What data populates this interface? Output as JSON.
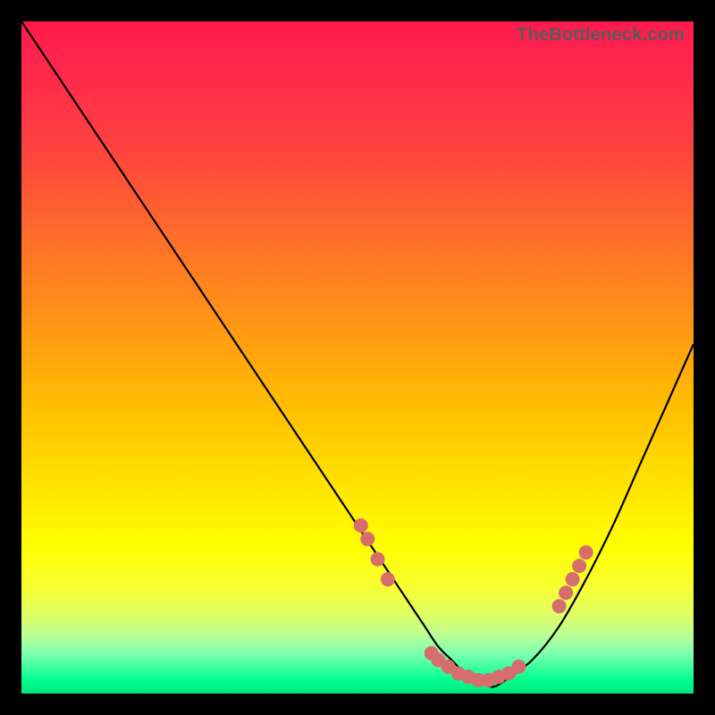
{
  "watermark": "TheBottleneck.com",
  "chart_data": {
    "type": "line",
    "title": "",
    "xlabel": "",
    "ylabel": "",
    "xlim": [
      0,
      100
    ],
    "ylim": [
      0,
      100
    ],
    "series": [
      {
        "name": "curve",
        "x": [
          0,
          4,
          8,
          12,
          16,
          20,
          24,
          28,
          32,
          36,
          40,
          44,
          48,
          50,
          52,
          54,
          56,
          58,
          60,
          62,
          64,
          66,
          68,
          70,
          72,
          76,
          80,
          84,
          88,
          92,
          96,
          100
        ],
        "y": [
          100,
          94,
          88,
          82,
          76,
          70,
          64,
          58,
          52,
          46,
          40,
          34,
          28,
          25,
          22,
          19,
          16,
          13,
          10,
          7,
          5,
          3,
          2,
          1,
          2,
          5,
          10,
          17,
          25,
          34,
          43,
          52
        ]
      }
    ],
    "markers": {
      "name": "dots",
      "color": "#d86d6d",
      "radius": 8,
      "points": [
        {
          "x": 50.5,
          "y": 25
        },
        {
          "x": 51.5,
          "y": 23
        },
        {
          "x": 53.0,
          "y": 20
        },
        {
          "x": 54.5,
          "y": 17
        },
        {
          "x": 61.0,
          "y": 6
        },
        {
          "x": 62.0,
          "y": 5
        },
        {
          "x": 63.5,
          "y": 4
        },
        {
          "x": 65.0,
          "y": 3
        },
        {
          "x": 66.5,
          "y": 2.5
        },
        {
          "x": 68.0,
          "y": 2
        },
        {
          "x": 69.5,
          "y": 2
        },
        {
          "x": 71.0,
          "y": 2.5
        },
        {
          "x": 72.5,
          "y": 3
        },
        {
          "x": 74.0,
          "y": 4
        },
        {
          "x": 80.0,
          "y": 13
        },
        {
          "x": 81.0,
          "y": 15
        },
        {
          "x": 82.0,
          "y": 17
        },
        {
          "x": 83.0,
          "y": 19
        },
        {
          "x": 84.0,
          "y": 21
        }
      ]
    },
    "gradient_stops": [
      {
        "pos": 0,
        "color": "#ff1a4d"
      },
      {
        "pos": 100,
        "color": "#00e878"
      }
    ]
  }
}
